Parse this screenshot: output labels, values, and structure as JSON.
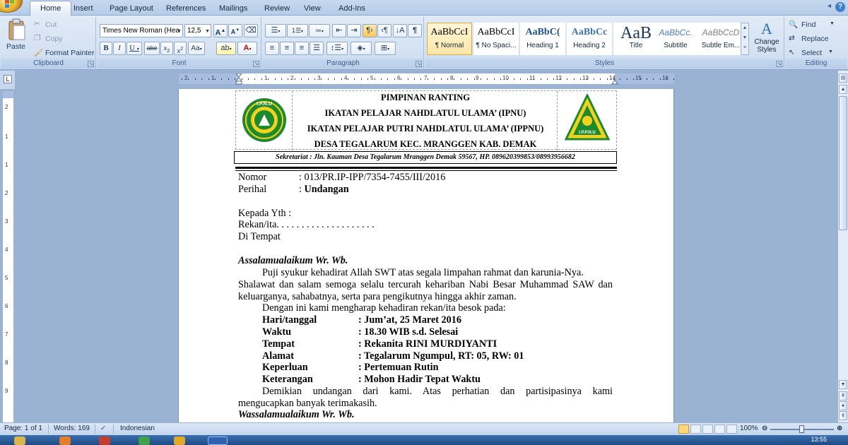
{
  "ribbon": {
    "tabs": [
      "Home",
      "Insert",
      "Page Layout",
      "References",
      "Mailings",
      "Review",
      "View",
      "Add-Ins"
    ],
    "active_tab": "Home",
    "clipboard": {
      "paste": "Paste",
      "cut": "Cut",
      "copy": "Copy",
      "format_painter": "Format Painter",
      "label": "Clipboard"
    },
    "font": {
      "family": "Times New Roman (Hea",
      "size": "12,5",
      "label": "Font"
    },
    "paragraph": {
      "label": "Paragraph"
    },
    "styles": {
      "label": "Styles",
      "items": [
        {
          "preview": "AaBbCcI",
          "name": "¶ Normal"
        },
        {
          "preview": "AaBbCcI",
          "name": "¶ No Spaci..."
        },
        {
          "preview": "AaBbC(",
          "name": "Heading 1"
        },
        {
          "preview": "AaBbCc",
          "name": "Heading 2"
        },
        {
          "preview": "AaB",
          "name": "Title"
        },
        {
          "preview": "AaBbCc.",
          "name": "Subtitle"
        },
        {
          "preview": "AaBbCcD",
          "name": "Subtle Em..."
        }
      ],
      "change": "Change Styles"
    },
    "editing": {
      "find": "Find",
      "replace": "Replace",
      "select": "Select",
      "label": "Editing"
    }
  },
  "ruler": {
    "marks": [
      "2",
      "1",
      "1",
      "2",
      "3",
      "4",
      "5",
      "6",
      "7",
      "8",
      "9",
      "10",
      "11",
      "12",
      "13",
      "14",
      "15",
      "16",
      "17",
      "18"
    ]
  },
  "document": {
    "kop": {
      "line1": "PIMPINAN RANTING",
      "line2": "IKATAN PELAJAR NAHDLATUL ULAMA’ (IPNU)",
      "line3": "IKATAN PELAJAR PUTRI NAHDLATUL ULAMA’ (IPPNU)",
      "line4": "DESA TEGALARUM KEC. MRANGGEN KAB. DEMAK",
      "logo_left_text": "I.P.N.U",
      "logo_right_text": "I.P.P.N.U",
      "sekretariat": "Sekretariat : Jln. Kauman Desa Tegalarum Mranggen Demak 59567, HP. 089620399853/08993956682"
    },
    "nomor_label": "Nomor",
    "nomor_value": ": 013/PR.IP-IPP/7354-7455/III/2016",
    "perihal_label": "Perihal",
    "perihal_colon": ": ",
    "perihal_value": "Undangan",
    "kepada": "Kepada Yth :",
    "rekan": "Rekan/ita. . . . . . . . . . . . . . . . . . . .",
    "tempat": "Di Tempat",
    "salam": "Assalamualaikum Wr. Wb.",
    "p1_l1": "Puji syukur kehadirat Allah SWT atas segala limpahan rahmat dan karunia-Nya.",
    "p1_l2": "Shalawat dan salam semoga selalu tercurah kehariban Nabi  Besar Muhammad SAW dan",
    "p1_l3": "keluarganya, sahabatnya, serta para pengikutnya hingga akhir zaman.",
    "p2": "Dengan ini kami mengharap kehadiran rekan/ita besok pada:",
    "details": [
      {
        "label": "Hari/tanggal",
        "value": ": Jum’at, 25 Maret 2016"
      },
      {
        "label": "Waktu",
        "value": ": 18.30 WIB s.d. Selesai"
      },
      {
        "label": "Tempat",
        "value": ": Rekanita RINI MURDIYANTI"
      },
      {
        "label": "Alamat",
        "value": ": Tegalarum Ngumpul, RT: 05, RW: 01"
      },
      {
        "label": "Keperluan",
        "value": ": Pertemuan Rutin"
      },
      {
        "label": "Keterangan",
        "value": ": Mohon Hadir Tepat Waktu"
      }
    ],
    "p3_l1": "Demikian undangan dari kami. Atas perhatian dan partisipasinya kami",
    "p3_l2": "mengucapkan banyak terimakasih.",
    "salam_penutup": "Wassalamualaikum Wr. Wb."
  },
  "status": {
    "page": "Page: 1 of 1",
    "words": "Words: 169",
    "language": "Indonesian",
    "zoom": "100%",
    "zoom_level": 1.0
  },
  "taskbar": {
    "clock": "13:55"
  },
  "colors": {
    "ribbon_bg": "#d3e1f2",
    "doc_bg": "#9bb3d2",
    "selected_style": "#ffe6a8",
    "logo_green": "#1e8a2e",
    "logo_yellow": "#f3d21b"
  }
}
